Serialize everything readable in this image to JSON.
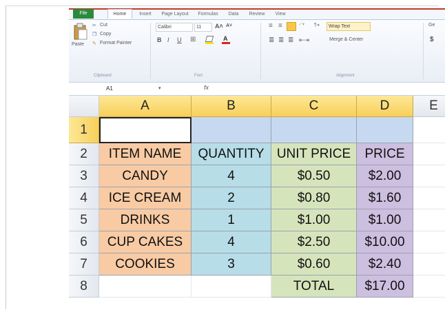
{
  "ribbon": {
    "tabs": [
      "File",
      "Home",
      "Insert",
      "Page Layout",
      "Formulas",
      "Data",
      "Review",
      "View"
    ],
    "clipboard": {
      "paste": "Paste",
      "cut": "Cut",
      "copy": "Copy",
      "format_painter": "Format Painter",
      "group": "Clipboard"
    },
    "font": {
      "name": "Calibri",
      "size": "11",
      "bold": "B",
      "italic": "I",
      "underline": "U",
      "group": "Font"
    },
    "alignment": {
      "wrap_text": "Wrap Text",
      "merge_center": "Merge & Center",
      "group": "Alignment"
    },
    "number": {
      "format_partial": "Ge",
      "currency": "$"
    }
  },
  "formula_bar": {
    "name_box": "A1",
    "fx": "fx",
    "formula": ""
  },
  "sheet": {
    "columns": [
      "A",
      "B",
      "C",
      "D",
      "E"
    ],
    "rows": [
      "1",
      "2",
      "3",
      "4",
      "5",
      "6",
      "7",
      "8"
    ],
    "headers": [
      "ITEM NAME",
      "QUANTITY",
      "UNIT PRICE",
      "PRICE"
    ],
    "items": [
      {
        "name": "CANDY",
        "qty": "4",
        "unit": "$0.50",
        "price": "$2.00"
      },
      {
        "name": "ICE CREAM",
        "qty": "2",
        "unit": "$0.80",
        "price": "$1.60"
      },
      {
        "name": "DRINKS",
        "qty": "1",
        "unit": "$1.00",
        "price": "$1.00"
      },
      {
        "name": "CUP CAKES",
        "qty": "4",
        "unit": "$2.50",
        "price": "$10.00"
      },
      {
        "name": "COOKIES",
        "qty": "3",
        "unit": "$0.60",
        "price": "$2.40"
      }
    ],
    "total_label": "TOTAL",
    "total_value": "$17.00"
  },
  "colors": {
    "item_col": "#f8cba4",
    "qty_col": "#b7dde8",
    "unit_col": "#d6e4bc",
    "price_col": "#cdbfe0",
    "row1_fill": "#c6d9f1"
  }
}
